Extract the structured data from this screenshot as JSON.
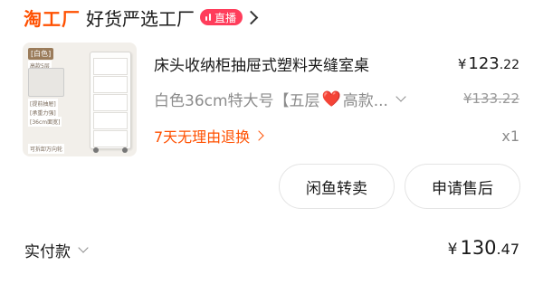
{
  "header": {
    "brand": "淘工厂",
    "subtitle": "好货严选工厂",
    "live_badge": "直播"
  },
  "product": {
    "image": {
      "tag": "[白色]",
      "tag_sub": "高款5层",
      "note_top": "抽屉规格尺寸",
      "note_mid": "[提前抽屉]",
      "note_mid2": "[承重力强]",
      "note_mid3": "[36cm面宽]",
      "note_bottom": "可拆卸万向轮"
    },
    "title": "床头收纳柜抽屉式塑料夹缝室桌",
    "price": {
      "currency": "¥",
      "integer": "123",
      "decimal": ".22"
    },
    "sku": {
      "prefix": "白色36cm特大号【五层",
      "heart": "❤️",
      "suffix": "高款..."
    },
    "original_price": "¥133.22",
    "return_policy": "7天无理由退换",
    "quantity": "x1"
  },
  "actions": {
    "idle_fish_resell": "闲鱼转卖",
    "after_sale": "申请售后"
  },
  "payment": {
    "label": "实付款",
    "currency": "¥",
    "integer": "130",
    "decimal": ".47"
  },
  "colors": {
    "brand": "#ff5000",
    "live_badge": "#ff3d5b",
    "muted_text": "#8c8c8c"
  }
}
